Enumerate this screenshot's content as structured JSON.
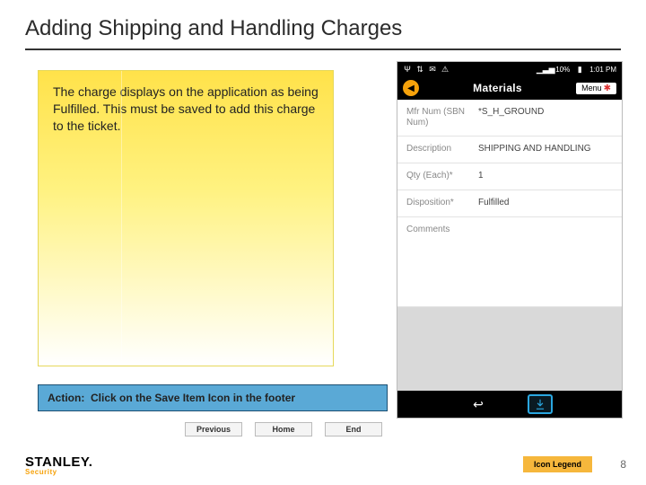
{
  "title": "Adding Shipping and Handling Charges",
  "note": "The charge displays on the application as being Fulfilled. This must be saved to add this charge to the ticket.",
  "action": {
    "label": "Action:",
    "text": "Click on the Save Item Icon in the footer"
  },
  "nav": {
    "previous": "Previous",
    "home": "Home",
    "end": "End"
  },
  "brand": {
    "name": "STANLEY",
    "sub": "Security"
  },
  "legend": "Icon Legend",
  "page_number": "8",
  "phone": {
    "statusbar": {
      "battery": "10%",
      "time": "1:01 PM"
    },
    "appbar": {
      "title": "Materials",
      "menu": "Menu"
    },
    "rows": [
      {
        "label": "Mfr Num (SBN Num)",
        "value": "*S_H_GROUND"
      },
      {
        "label": "Description",
        "value": "SHIPPING AND HANDLING"
      },
      {
        "label": "Qty (Each)*",
        "value": "1"
      },
      {
        "label": "Disposition*",
        "value": "Fulfilled"
      },
      {
        "label": "Comments",
        "value": ""
      }
    ]
  }
}
